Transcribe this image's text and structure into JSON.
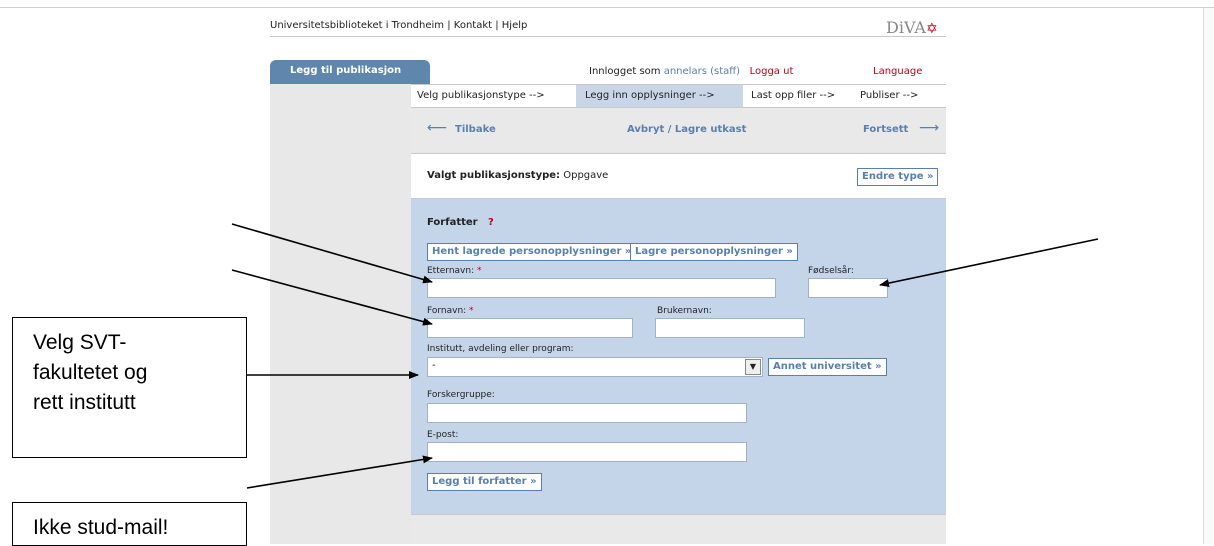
{
  "top_nav": {
    "library": "Universitetsbiblioteket i Trondheim",
    "sep1": " | ",
    "contact": "Kontakt",
    "sep2": " | ",
    "help": "Hjelp"
  },
  "logo": {
    "text": "DiVA",
    "star": "✡"
  },
  "sidebar": {
    "tab_label": "Legg til publikasjon"
  },
  "header": {
    "logged_in_prefix": "Innlogget som ",
    "user": "annelars (staff)",
    "logout": "Logga ut",
    "language": "Language"
  },
  "steps": [
    {
      "label": "Velg publikasjonstype -->"
    },
    {
      "label": "Legg inn opplysninger -->"
    },
    {
      "label": "Last opp filer -->"
    },
    {
      "label": "Publiser -->"
    }
  ],
  "nav": {
    "back": "Tilbake",
    "cancel_save": "Avbryt / Lagre utkast",
    "next": "Fortsett"
  },
  "type": {
    "label": "Valgt publikasjonstype:",
    "value": " Oppgave",
    "change_button": "Endre type »"
  },
  "form": {
    "section_title": "Forfatter",
    "help_mark": "?",
    "fetch_button": "Hent lagrede personopplysninger »",
    "save_button": "Lagre personopplysninger »",
    "lastname_label": "Etternavn:",
    "birthyear_label": "Fødselsår:",
    "firstname_label": "Fornavn:",
    "username_label": "Brukernavn:",
    "required_mark": " *",
    "institute_label": "Institutt, avdeling eller program:",
    "institute_value": "-",
    "other_university_button": "Annet universitet »",
    "research_group_label": "Forskergruppe:",
    "email_label": "E-post:",
    "add_author_button": "Legg til forfatter »"
  },
  "annotations": {
    "callout1_line1": "Velg SVT-",
    "callout1_line2": "fakultetet og",
    "callout1_line3": "rett institutt",
    "callout2": "Ikke stud-mail!"
  },
  "colors": {
    "accent": "#5a7fae",
    "required": "#c0001b",
    "form_bg": "#c4d5ea"
  }
}
